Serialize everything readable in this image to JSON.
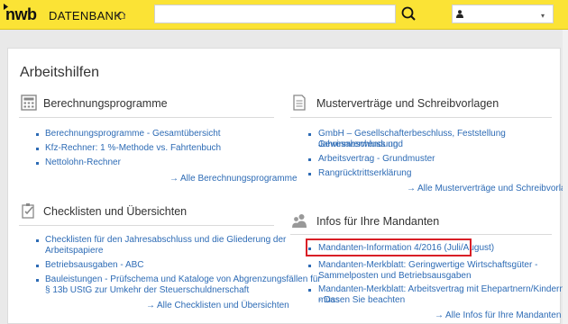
{
  "header": {
    "logo": "nwb",
    "logo_sub": "DATENBANK",
    "search_placeholder": "",
    "brand_color": "#fbe335"
  },
  "page": {
    "title": "Arbeitshilfen"
  },
  "sections": {
    "berechnung": {
      "title": "Berechnungsprogramme",
      "icon": "calculator-icon",
      "items": [
        "Berechnungsprogramme - Gesamtübersicht",
        "Kfz-Rechner: 1 %-Methode vs. Fahrtenbuch",
        "Nettolohn-Rechner"
      ],
      "more": "Alle Berechnungsprogramme"
    },
    "checklisten": {
      "title": "Checklisten und Übersichten",
      "icon": "checklist-icon",
      "items": [
        "Checklisten für den Jahresabschluss und die Gliederung der",
        "Arbeitspapiere",
        "Betriebsausgaben - ABC",
        "Bauleistungen - Prüfschema und Kataloge von Abgrenzungsfällen für",
        "§ 13b UStG zur Umkehr der Steuerschuldnerschaft"
      ],
      "more": "Alle Checklisten und Übersichten"
    },
    "muster": {
      "title": "Musterverträge und Schreibvorlagen",
      "icon": "document-icon",
      "items": [
        "GmbH – Gesellschafterbeschluss, Feststellung Jahresabschluss und",
        "Gewinnverwendung",
        "Arbeitsvertrag - Grundmuster",
        "Rangrücktrittserklärung"
      ],
      "more": "Alle Musterverträge und Schreibvorlagen"
    },
    "mandanten": {
      "title": "Infos für Ihre Mandanten",
      "icon": "users-icon",
      "items": [
        "Mandanten-Information 4/2016 (Juli/August)",
        "Mandanten-Merkblatt: Geringwertige Wirtschaftsgüter -",
        "Sammelposten und Betriebsausgaben",
        "Mandanten-Merkblatt: Arbeitsvertrag mit Ehepartnern/Kindern - Das",
        "müssen Sie beachten"
      ],
      "more": "Alle Infos für Ihre Mandanten"
    }
  },
  "colors": {
    "link": "#2d6bb5",
    "highlight": "#d91f26"
  }
}
